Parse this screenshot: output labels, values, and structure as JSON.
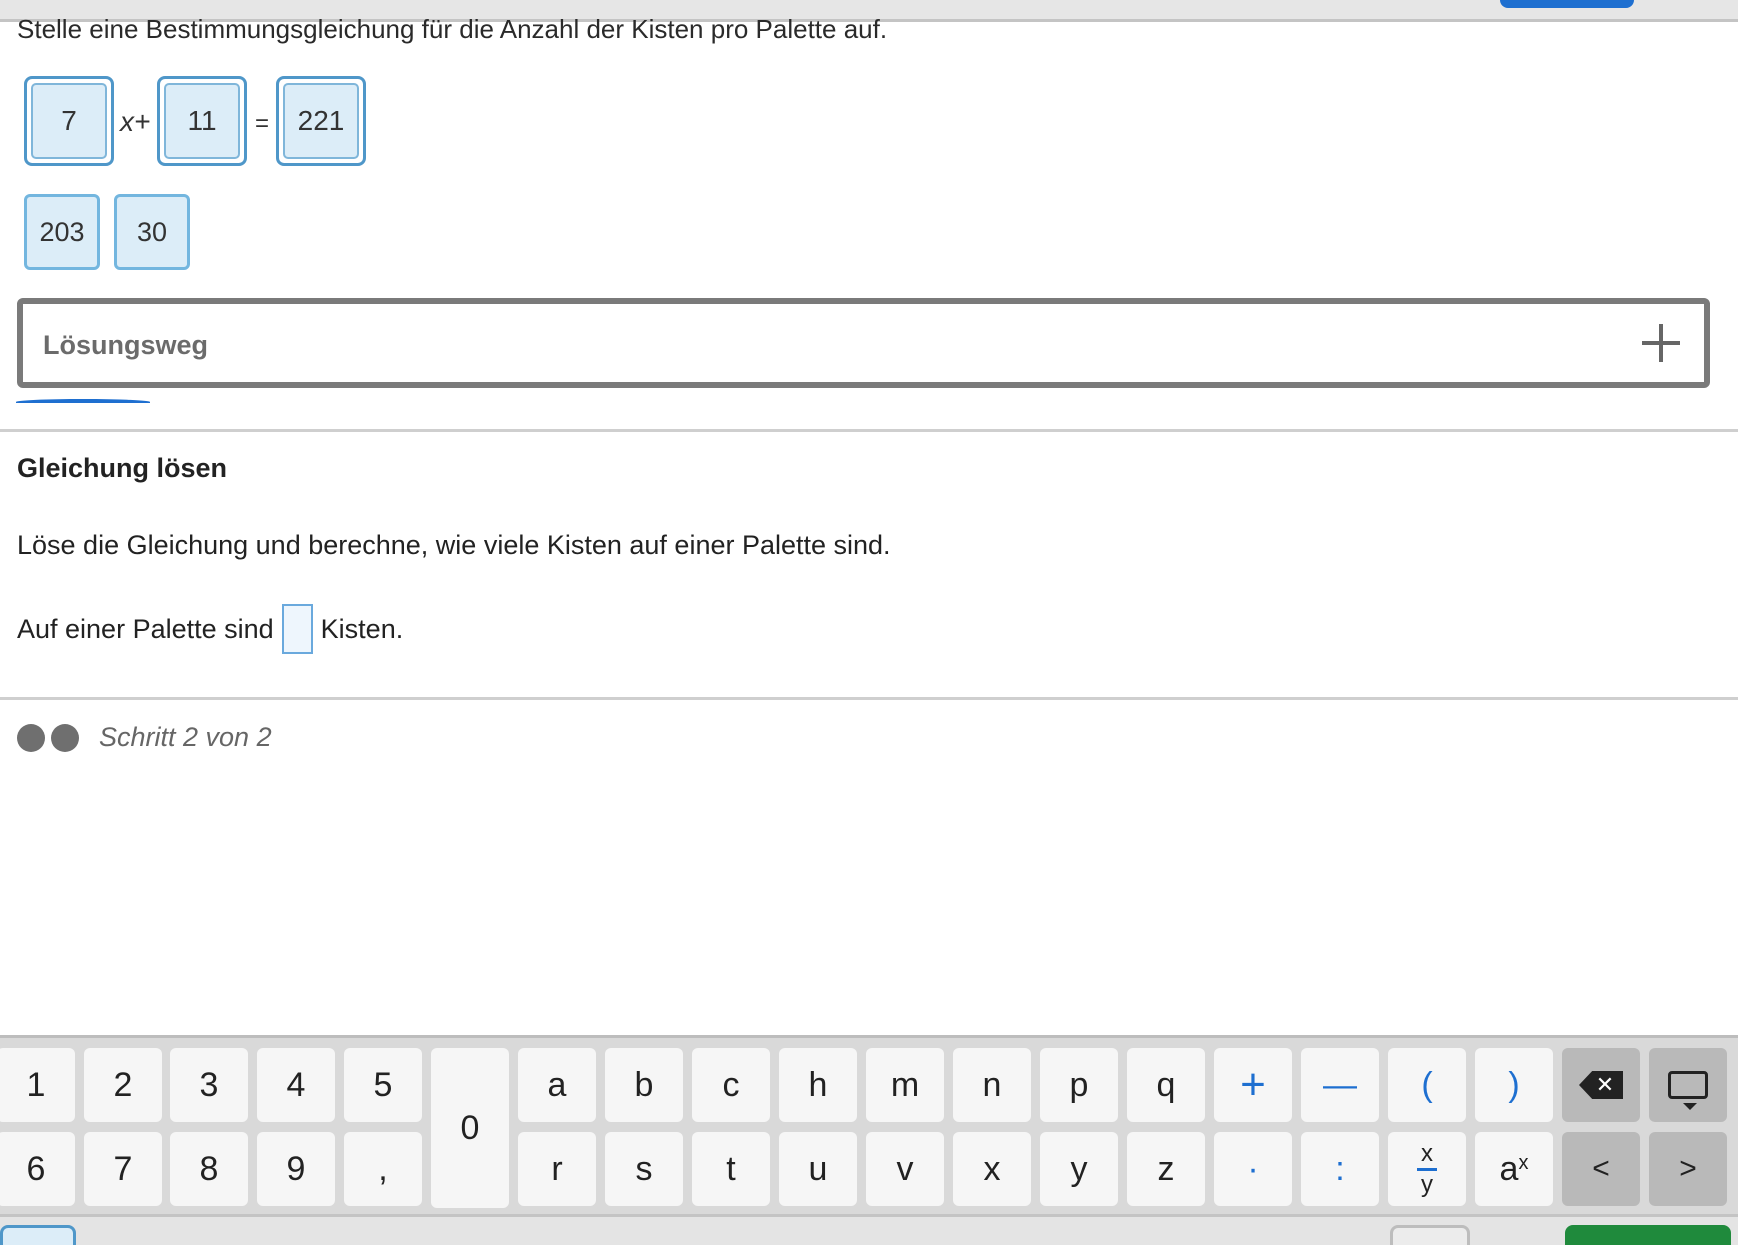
{
  "task": {
    "intro": "Stelle eine Bestimmungsgleichung für die Anzahl der Kisten pro Palette auf."
  },
  "equation": {
    "slot1": "7",
    "var_op": "x+",
    "slot2": "11",
    "equals": "=",
    "slot3": "221"
  },
  "pool": [
    "203",
    "30"
  ],
  "loesungsweg": {
    "label": "Lösungsweg"
  },
  "step": {
    "title": "Gleichung lösen",
    "instruction": "Löse die Gleichung und berechne, wie viele Kisten auf einer Palette sind.",
    "answer_before": "Auf einer Palette sind",
    "answer_after": "Kisten.",
    "answer_value": ""
  },
  "progress": {
    "text": "Schritt 2 von 2"
  },
  "keyboard": {
    "row1": [
      "1",
      "2",
      "3",
      "4",
      "5",
      "a",
      "b",
      "c",
      "h",
      "m",
      "n",
      "p",
      "q",
      "+",
      "—",
      "(",
      ")"
    ],
    "zero": "0",
    "row2": [
      "6",
      "7",
      "8",
      "9",
      ",",
      "r",
      "s",
      "t",
      "u",
      "v",
      "x",
      "y",
      "z",
      "·",
      ":"
    ],
    "frac": {
      "num": "x",
      "den": "y"
    },
    "power": {
      "base": "a",
      "exp": "x"
    },
    "left": "<",
    "right": ">"
  },
  "colors": {
    "accent": "#1e6fd0",
    "tile": "#dcedf8",
    "tile_border": "#4f97c9",
    "confirm": "#1f8a3c"
  }
}
